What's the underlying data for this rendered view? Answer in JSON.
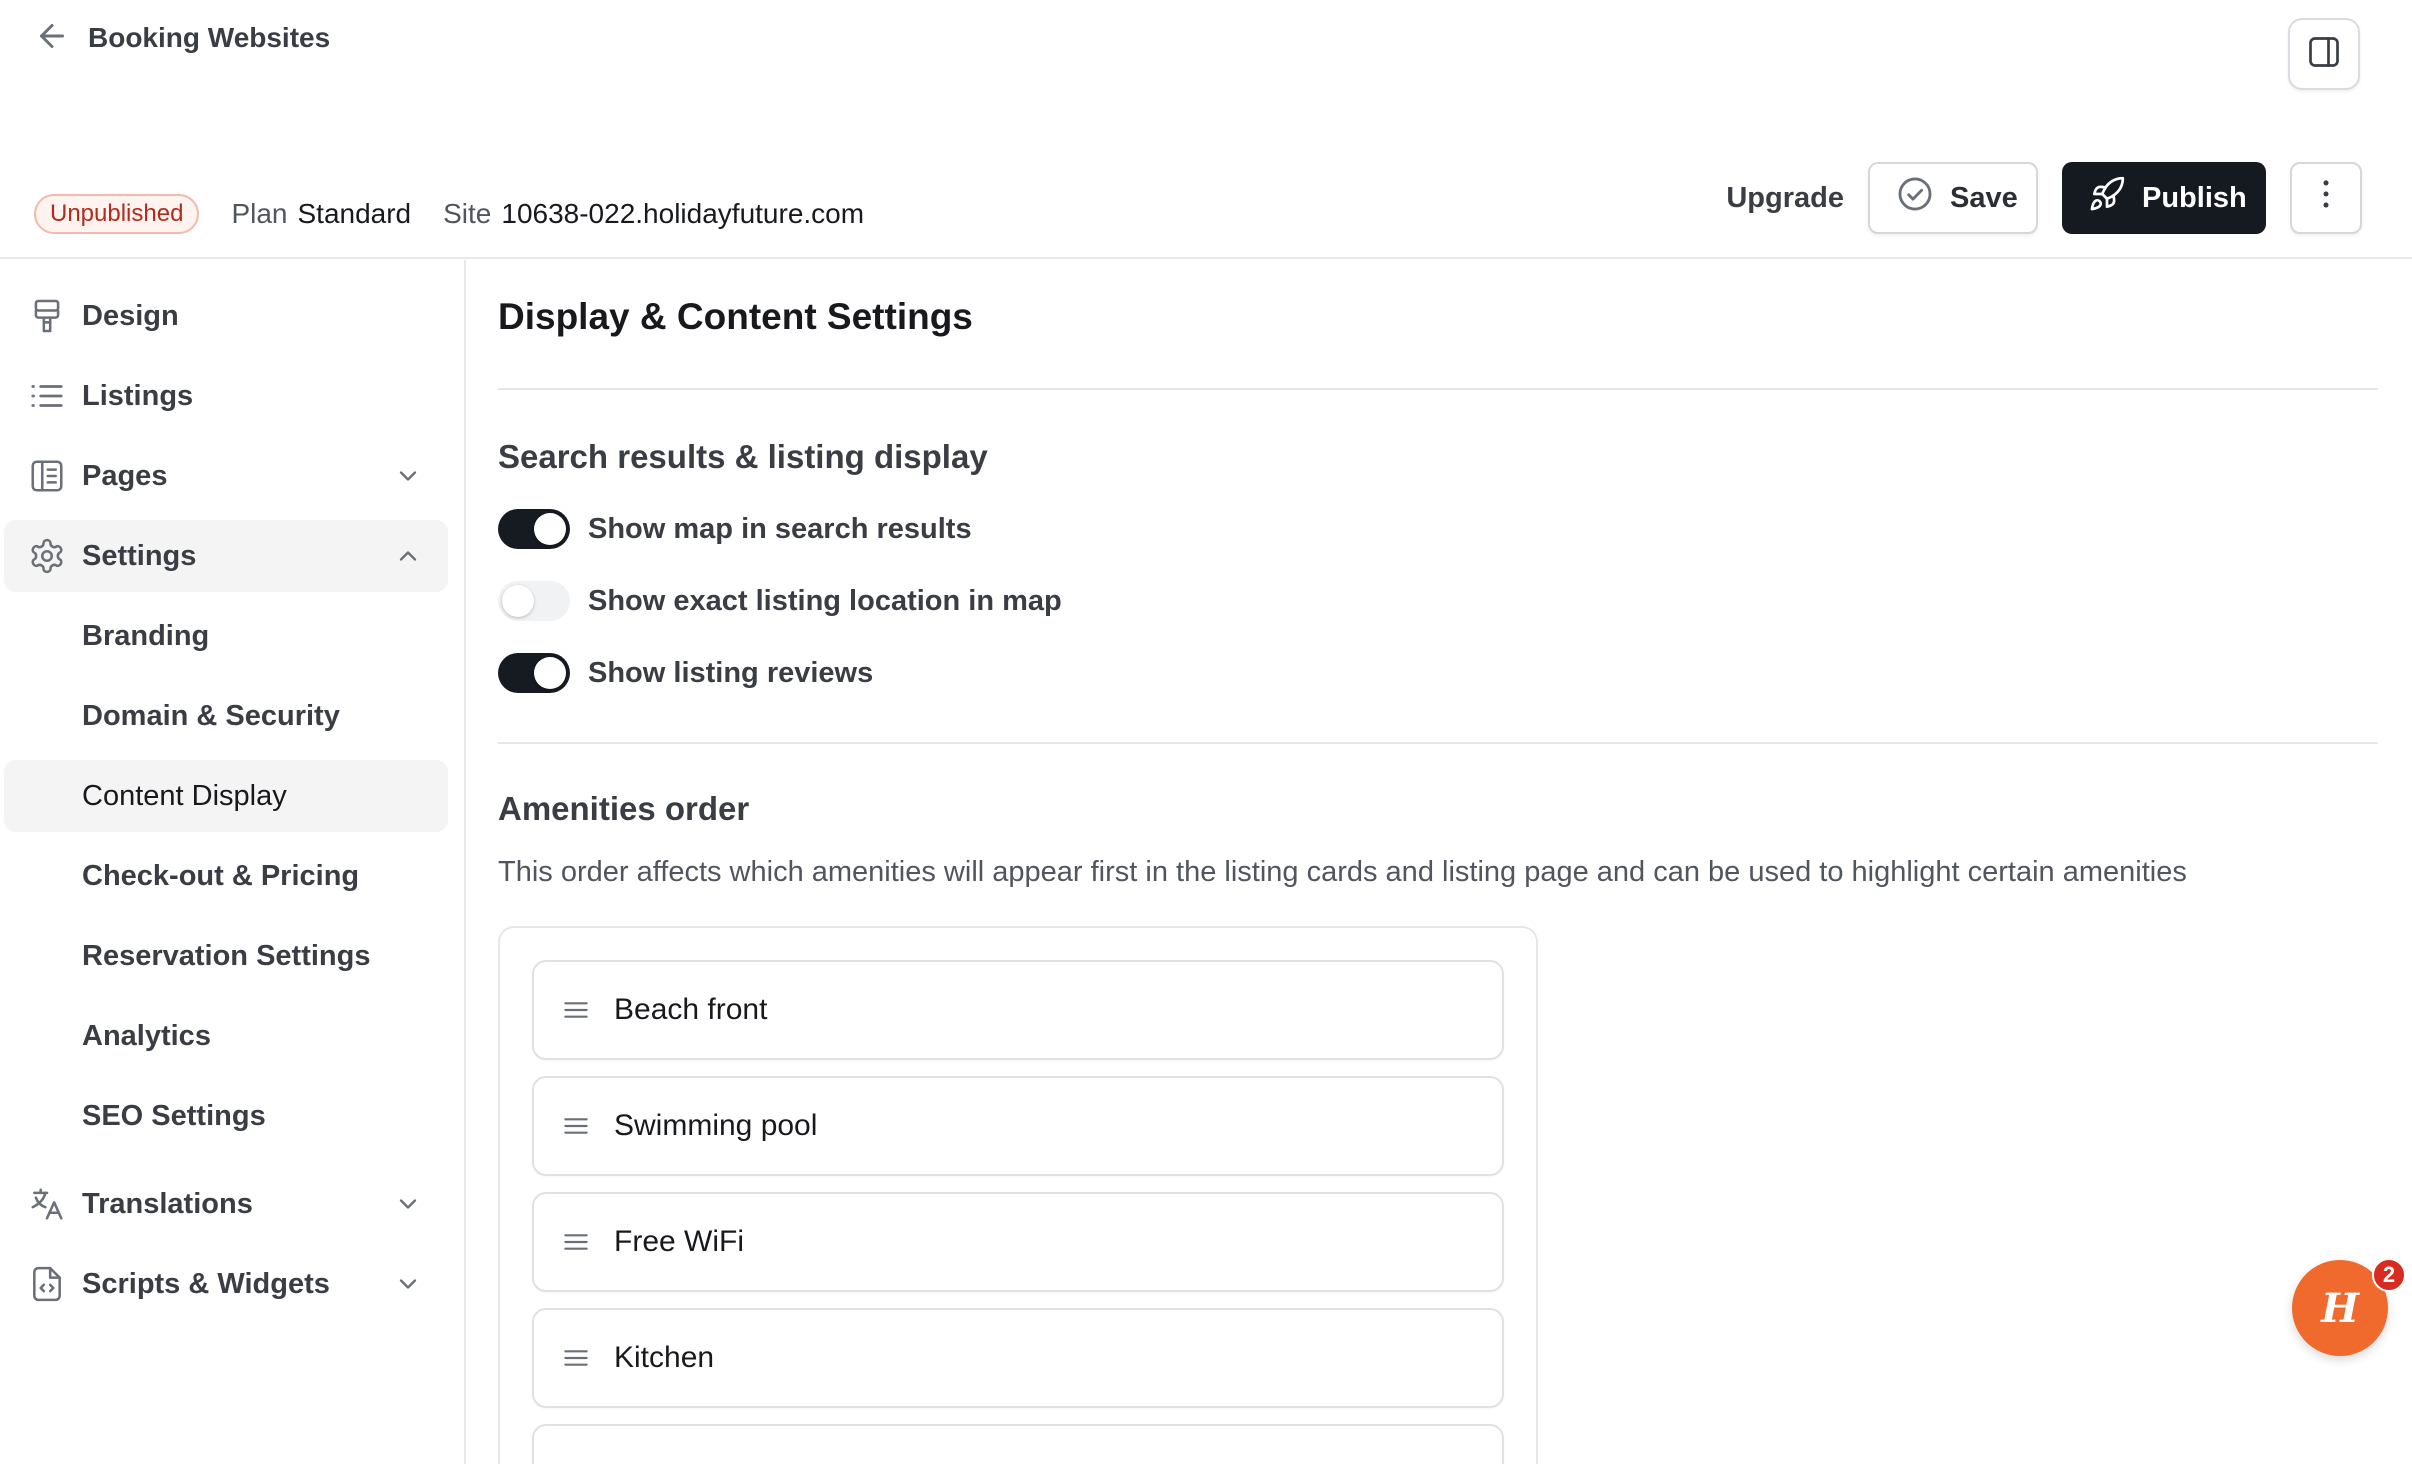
{
  "header": {
    "back_label": "Booking Websites",
    "status_badge": "Unpublished",
    "plan_label": "Plan",
    "plan_value": "Standard",
    "site_label": "Site",
    "site_value": "10638-022.holidayfuture.com",
    "upgrade_label": "Upgrade",
    "save_label": "Save",
    "publish_label": "Publish"
  },
  "sidebar": {
    "items": [
      {
        "label": "Design",
        "icon": "paint-roller-icon"
      },
      {
        "label": "Listings",
        "icon": "list-icon"
      },
      {
        "label": "Pages",
        "icon": "book-icon",
        "expandable": true,
        "expanded": false
      },
      {
        "label": "Settings",
        "icon": "gear-icon",
        "expandable": true,
        "expanded": true,
        "active": true
      },
      {
        "label": "Translations",
        "icon": "translate-icon",
        "expandable": true,
        "expanded": false
      },
      {
        "label": "Scripts & Widgets",
        "icon": "code-file-icon",
        "expandable": true,
        "expanded": false
      }
    ],
    "settings_sub": [
      {
        "label": "Branding"
      },
      {
        "label": "Domain & Security"
      },
      {
        "label": "Content Display",
        "active": true
      },
      {
        "label": "Check-out & Pricing"
      },
      {
        "label": "Reservation Settings"
      },
      {
        "label": "Analytics"
      },
      {
        "label": "SEO Settings"
      }
    ]
  },
  "main": {
    "title": "Display & Content Settings",
    "search_section": {
      "title": "Search results & listing display",
      "toggles": [
        {
          "label": "Show map in search results",
          "on": true
        },
        {
          "label": "Show exact listing location in map",
          "on": false
        },
        {
          "label": "Show listing reviews",
          "on": true
        }
      ]
    },
    "amenities_section": {
      "title": "Amenities order",
      "description": "This order affects which amenities will appear first in the listing cards and listing page and can be used to highlight certain amenities",
      "items": [
        "Beach front",
        "Swimming pool",
        "Free WiFi",
        "Kitchen"
      ]
    }
  },
  "chat_widget": {
    "glyph": "H",
    "unread_count": "2",
    "color": "#ef6a2c"
  },
  "colors": {
    "primary_dark": "#151a21",
    "badge_red": "#b42a1c",
    "accent_orange": "#ef6a2c"
  }
}
